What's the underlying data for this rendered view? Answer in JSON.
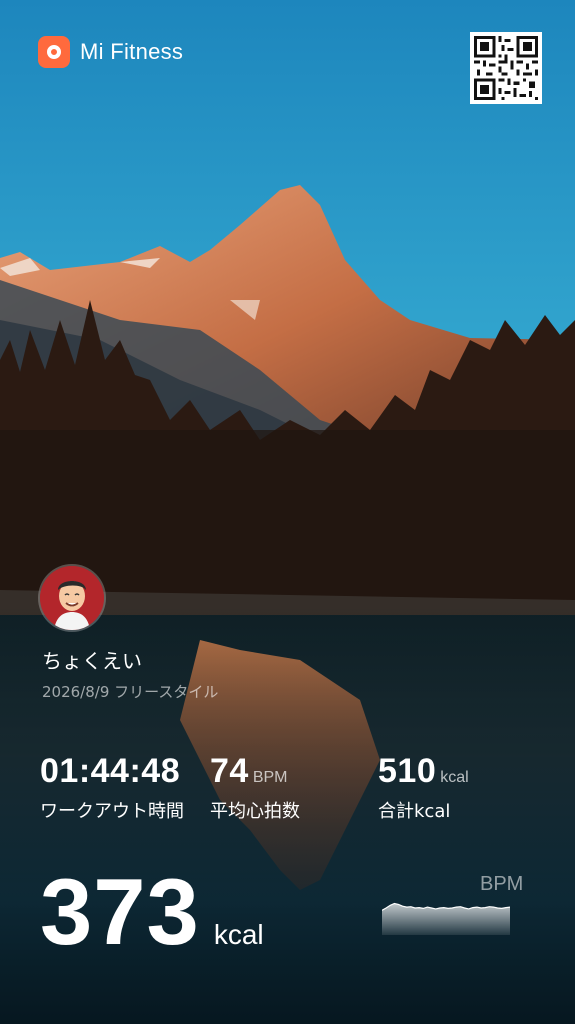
{
  "header": {
    "app_name": "Mi Fitness",
    "logo_icon": "mi-fitness-logo-icon",
    "qr_icon": "qr-code-icon",
    "accent": "#ff6a3d"
  },
  "user": {
    "name": "ちょくえい",
    "avatar_icon": "cartoon-avatar-icon",
    "date_activity": "2026/8/9 フリースタイル"
  },
  "stats": {
    "duration": {
      "value": "01:44:48",
      "label": "ワークアウト時間"
    },
    "avg_hr": {
      "value": "74",
      "unit": "BPM",
      "label": "平均心拍数"
    },
    "total_kcal": {
      "value": "510",
      "unit": "kcal",
      "label": "合計kcal"
    }
  },
  "active_kcal": {
    "value": "373",
    "unit": "kcal"
  },
  "heart_rate_chart": {
    "label": "BPM",
    "values": [
      55,
      60,
      66,
      70,
      68,
      64,
      62,
      63,
      60,
      61,
      59,
      62,
      60,
      58,
      60,
      61,
      59,
      60,
      62,
      63,
      60,
      58,
      61,
      62,
      60,
      61,
      63,
      62,
      60,
      59,
      61,
      62
    ]
  }
}
